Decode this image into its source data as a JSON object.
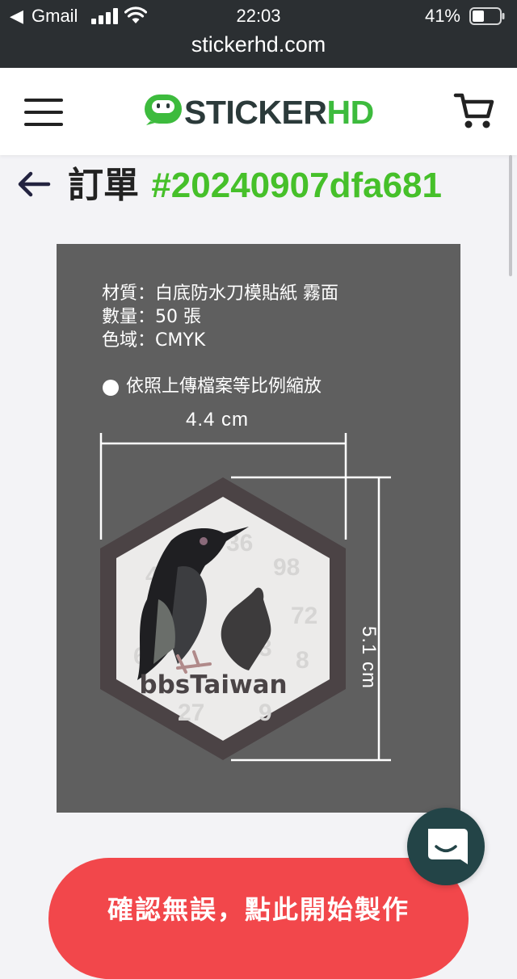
{
  "status_bar": {
    "back": "◀",
    "carrier": "Gmail",
    "time": "22:03",
    "battery": "41%"
  },
  "browser": {
    "url": "stickerhd.com"
  },
  "header": {
    "logo_part1": "STICKER",
    "logo_part2": "HD",
    "brand_color": "#3dbb3d"
  },
  "order": {
    "prefix": "訂單 ",
    "number": "#20240907dfa681"
  },
  "preview": {
    "specs": [
      "材質：白底防水刀模貼紙 霧面",
      "數量：50 張",
      "色域：CMYK"
    ],
    "scale_note": "依照上傳檔案等比例縮放",
    "width_label": "4.4 cm",
    "height_label": "5.1 cm",
    "sticker_text": "bbsTaiwan"
  },
  "cta": {
    "label": "確認無誤，點此開始製作"
  },
  "colors": {
    "cta": "#f2474b",
    "order_number": "#46c02a",
    "chat": "#234447"
  },
  "icons": [
    "menu-icon",
    "cart-icon",
    "back-arrow-icon",
    "chat-icon",
    "signal-icon",
    "wifi-icon",
    "battery-icon"
  ]
}
